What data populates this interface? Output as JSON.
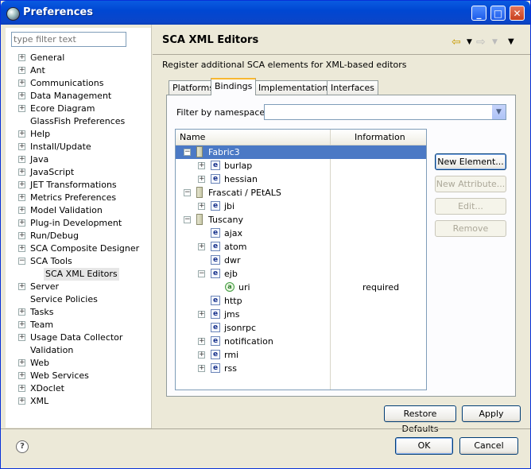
{
  "window": {
    "title": "Preferences"
  },
  "filter": {
    "placeholder": "type filter text"
  },
  "nav": {
    "items": [
      {
        "label": "General",
        "level": 0,
        "expander": "+"
      },
      {
        "label": "Ant",
        "level": 0,
        "expander": "+"
      },
      {
        "label": "Communications",
        "level": 0,
        "expander": "+"
      },
      {
        "label": "Data Management",
        "level": 0,
        "expander": "+"
      },
      {
        "label": "Ecore Diagram",
        "level": 0,
        "expander": "+"
      },
      {
        "label": "GlassFish Preferences",
        "level": 0,
        "expander": ""
      },
      {
        "label": "Help",
        "level": 0,
        "expander": "+"
      },
      {
        "label": "Install/Update",
        "level": 0,
        "expander": "+"
      },
      {
        "label": "Java",
        "level": 0,
        "expander": "+"
      },
      {
        "label": "JavaScript",
        "level": 0,
        "expander": "+"
      },
      {
        "label": "JET Transformations",
        "level": 0,
        "expander": "+"
      },
      {
        "label": "Metrics Preferences",
        "level": 0,
        "expander": "+"
      },
      {
        "label": "Model Validation",
        "level": 0,
        "expander": "+"
      },
      {
        "label": "Plug-in Development",
        "level": 0,
        "expander": "+"
      },
      {
        "label": "Run/Debug",
        "level": 0,
        "expander": "+"
      },
      {
        "label": "SCA Composite Designer",
        "level": 0,
        "expander": "+"
      },
      {
        "label": "SCA Tools",
        "level": 0,
        "expander": "-"
      },
      {
        "label": "SCA XML Editors",
        "level": 1,
        "expander": "",
        "selected": true
      },
      {
        "label": "Server",
        "level": 0,
        "expander": "+"
      },
      {
        "label": "Service Policies",
        "level": 0,
        "expander": ""
      },
      {
        "label": "Tasks",
        "level": 0,
        "expander": "+"
      },
      {
        "label": "Team",
        "level": 0,
        "expander": "+"
      },
      {
        "label": "Usage Data Collector",
        "level": 0,
        "expander": "+"
      },
      {
        "label": "Validation",
        "level": 0,
        "expander": ""
      },
      {
        "label": "Web",
        "level": 0,
        "expander": "+"
      },
      {
        "label": "Web Services",
        "level": 0,
        "expander": "+"
      },
      {
        "label": "XDoclet",
        "level": 0,
        "expander": "+"
      },
      {
        "label": "XML",
        "level": 0,
        "expander": "+"
      }
    ]
  },
  "page": {
    "title": "SCA XML Editors",
    "description": "Register additional SCA elements for XML-based editors",
    "tabs": [
      "Platforms",
      "Bindings",
      "Implementations",
      "Interfaces"
    ],
    "active_tab": "Bindings",
    "filter_label": "Filter by namespace:",
    "filter_value": "",
    "columns": {
      "name": "Name",
      "info": "Information"
    },
    "tree": [
      {
        "label": "Fabric3",
        "level": 0,
        "expander": "-",
        "icon": "folder",
        "info": "",
        "selected": true
      },
      {
        "label": "burlap",
        "level": 1,
        "expander": "+",
        "icon": "element",
        "info": ""
      },
      {
        "label": "hessian",
        "level": 1,
        "expander": "+",
        "icon": "element",
        "info": ""
      },
      {
        "label": "Frascati / PEtALS",
        "level": 0,
        "expander": "-",
        "icon": "folder",
        "info": ""
      },
      {
        "label": "jbi",
        "level": 1,
        "expander": "+",
        "icon": "element",
        "info": ""
      },
      {
        "label": "Tuscany",
        "level": 0,
        "expander": "-",
        "icon": "folder",
        "info": ""
      },
      {
        "label": "ajax",
        "level": 1,
        "expander": "",
        "icon": "element",
        "info": ""
      },
      {
        "label": "atom",
        "level": 1,
        "expander": "+",
        "icon": "element",
        "info": ""
      },
      {
        "label": "dwr",
        "level": 1,
        "expander": "",
        "icon": "element",
        "info": ""
      },
      {
        "label": "ejb",
        "level": 1,
        "expander": "-",
        "icon": "element",
        "info": ""
      },
      {
        "label": "uri",
        "level": 2,
        "expander": "",
        "icon": "attribute",
        "info": "required"
      },
      {
        "label": "http",
        "level": 1,
        "expander": "",
        "icon": "element",
        "info": ""
      },
      {
        "label": "jms",
        "level": 1,
        "expander": "+",
        "icon": "element",
        "info": ""
      },
      {
        "label": "jsonrpc",
        "level": 1,
        "expander": "",
        "icon": "element",
        "info": ""
      },
      {
        "label": "notification",
        "level": 1,
        "expander": "+",
        "icon": "element",
        "info": ""
      },
      {
        "label": "rmi",
        "level": 1,
        "expander": "+",
        "icon": "element",
        "info": ""
      },
      {
        "label": "rss",
        "level": 1,
        "expander": "+",
        "icon": "element",
        "info": ""
      }
    ],
    "side_buttons": [
      {
        "label": "New Element...",
        "enabled": true
      },
      {
        "label": "New Attribute...",
        "enabled": false
      },
      {
        "label": "Edit...",
        "enabled": false
      },
      {
        "label": "Remove",
        "enabled": false
      }
    ],
    "restore_defaults": "Restore Defaults",
    "apply": "Apply"
  },
  "footer": {
    "ok": "OK",
    "cancel": "Cancel"
  },
  "icons": {
    "element_glyph": "e",
    "attribute_glyph": "a",
    "help_glyph": "?"
  }
}
